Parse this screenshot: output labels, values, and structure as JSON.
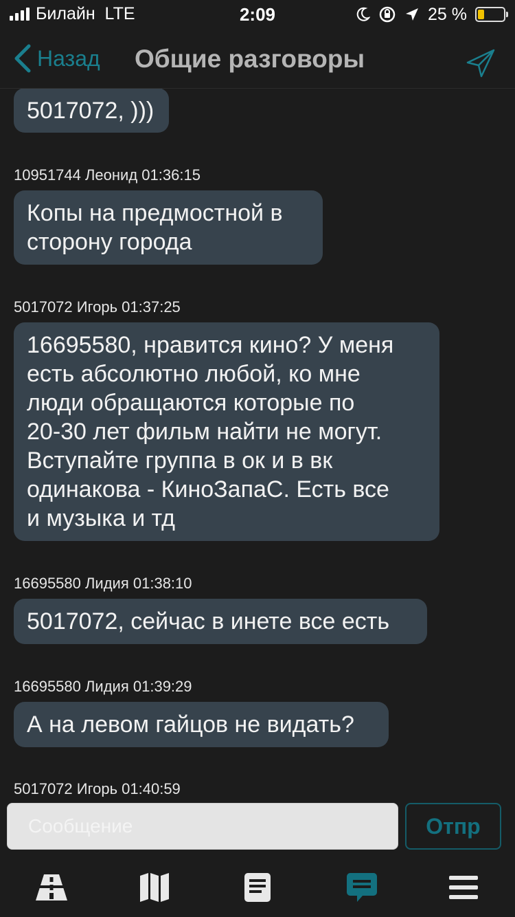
{
  "status_bar": {
    "carrier": "Билайн",
    "network": "LTE",
    "time": "2:09",
    "battery_percent": "25 %",
    "battery_level": 0.25,
    "icons": [
      "signal-icon",
      "moon-icon",
      "orientation-lock-icon",
      "location-arrow-icon",
      "battery-icon"
    ]
  },
  "nav": {
    "back_label": "Назад",
    "title": "Общие разговоры",
    "right_icon": "send-icon"
  },
  "messages": [
    {
      "meta": "",
      "text": "5017072, )))"
    },
    {
      "meta": "10951744 Леонид 01:36:15",
      "text": "Копы на предмостной в\nсторону города"
    },
    {
      "meta": "5017072 Игорь 01:37:25",
      "text": "16695580, нравится кино? У меня\nесть абсолютно любой, ко мне\nлюди обращаются которые по\n20-30 лет фильм найти не могут.\nВступайте группа в ок и в вк\nодинакова - КиноЗапаС. Есть все\nи музыка и тд"
    },
    {
      "meta": "16695580 Лидия 01:38:10",
      "text": "5017072, сейчас в инете все есть"
    },
    {
      "meta": "16695580 Лидия 01:39:29",
      "text": "А на левом гайцов не видать?"
    },
    {
      "meta": "5017072 Игорь 01:40:59",
      "text": ""
    }
  ],
  "composer": {
    "placeholder": "Сообщение",
    "value": "",
    "send_label": "Отпр"
  },
  "tabs": [
    {
      "icon": "road-icon",
      "active": false
    },
    {
      "icon": "map-icon",
      "active": false
    },
    {
      "icon": "document-icon",
      "active": false
    },
    {
      "icon": "chat-icon",
      "active": true
    },
    {
      "icon": "menu-icon",
      "active": false
    }
  ],
  "colors": {
    "background": "#1c1c1c",
    "bubble": "#37434d",
    "accent": "#1a7f8e",
    "tab_inactive": "#e8e8e8",
    "tab_active": "#13707f"
  }
}
